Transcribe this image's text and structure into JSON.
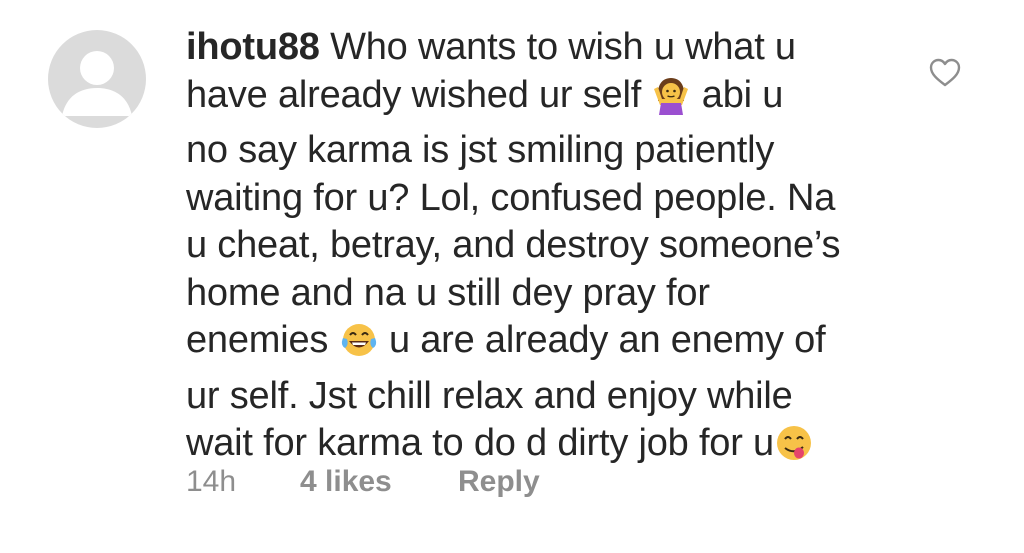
{
  "comment": {
    "username": "ihotu88",
    "lines": [
      " Who wants to wish u what u",
      "have already wished ur self ",
      " abi u",
      "no say karma is jst smiling patiently",
      "waiting for u? Lol, confused people. Na",
      "u cheat, betray, and destroy someone’s",
      "home and na u still dey pray for",
      "enemies ",
      " u are already an enemy of",
      "ur self. Jst chill relax and enjoy while",
      "wait for karma to do d dirty job for u"
    ],
    "emojis": [
      "person-shrugging-emoji",
      "tears-of-joy-emoji",
      "face-savoring-food-emoji"
    ]
  },
  "meta": {
    "time": "14h",
    "likes": "4 likes",
    "reply": "Reply"
  },
  "icons": {
    "avatar": "default-avatar-icon",
    "like": "heart-outline-icon"
  },
  "colors": {
    "text": "#262626",
    "secondary_text": "#8e8e8e",
    "avatar_bg": "#dbdbdb"
  }
}
